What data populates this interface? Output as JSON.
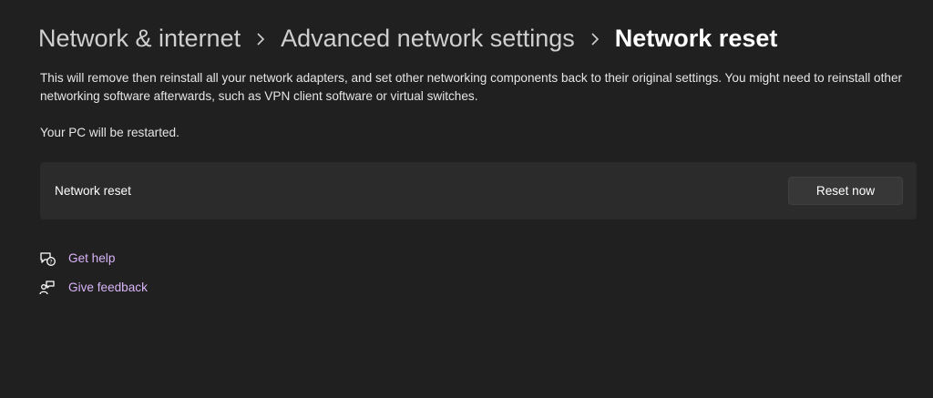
{
  "breadcrumb": {
    "items": [
      {
        "label": "Network & internet"
      },
      {
        "label": "Advanced network settings"
      },
      {
        "label": "Network reset"
      }
    ]
  },
  "description": "This will remove then reinstall all your network adapters, and set other networking components back to their original settings. You might need to reinstall other networking software afterwards, such as VPN client software or virtual switches.",
  "restart_note": "Your PC will be restarted.",
  "reset_card": {
    "label": "Network reset",
    "button_label": "Reset now"
  },
  "help_links": {
    "get_help": {
      "label": "Get help",
      "icon": "get-help-icon"
    },
    "give_feedback": {
      "label": "Give feedback",
      "icon": "feedback-icon"
    }
  },
  "colors": {
    "background": "#202020",
    "card": "#2b2b2b",
    "button": "#373737",
    "link": "#d8b4f8"
  }
}
